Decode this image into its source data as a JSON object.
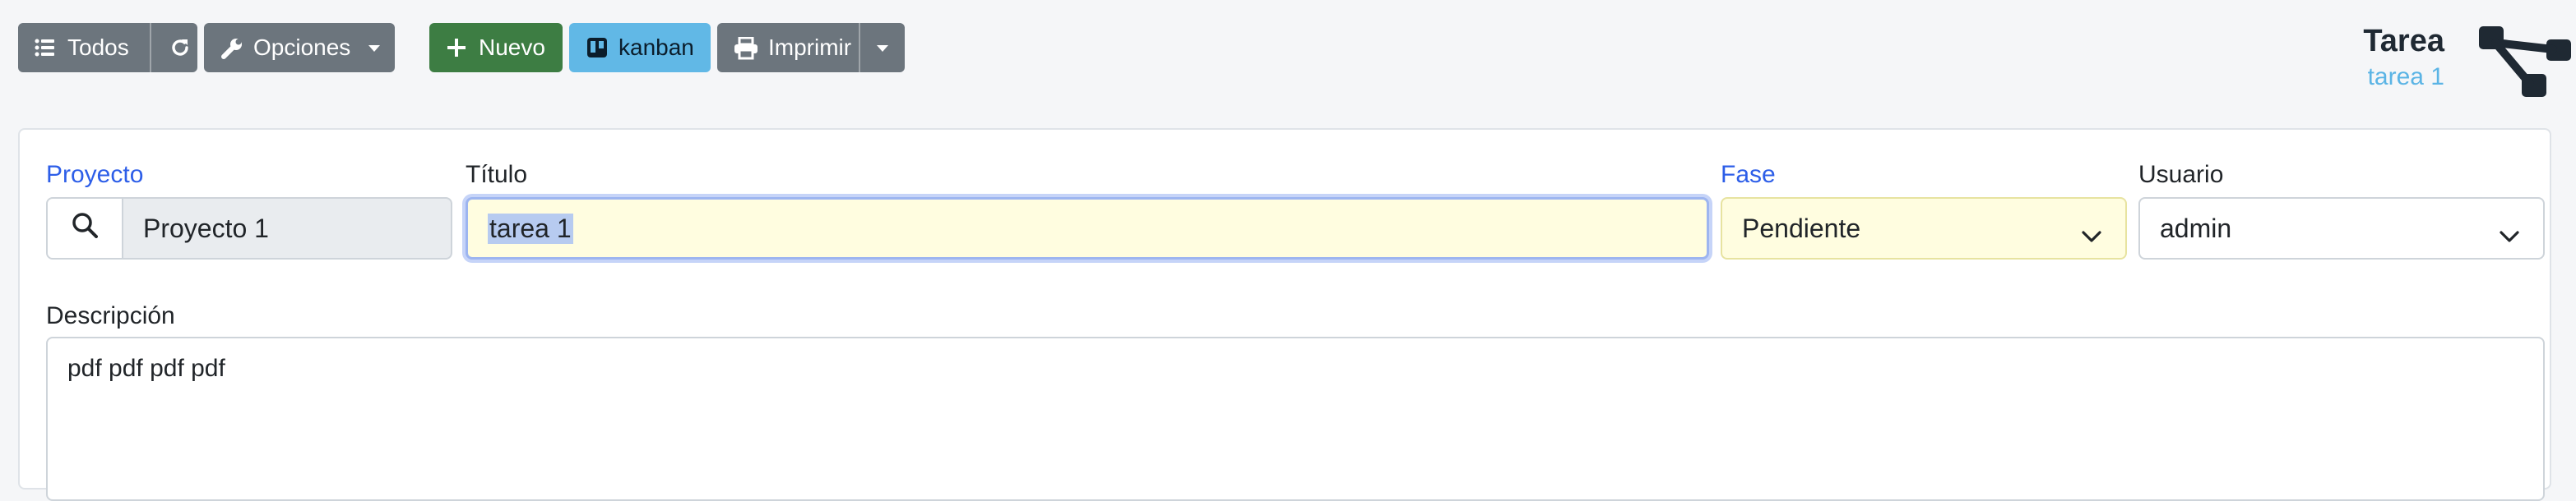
{
  "toolbar": {
    "todos_label": "Todos",
    "opciones_label": "Opciones",
    "nuevo_label": "Nuevo",
    "kanban_label": "kanban",
    "imprimir_label": "Imprimir"
  },
  "header": {
    "title": "Tarea",
    "subtitle": "tarea 1"
  },
  "form": {
    "proyecto": {
      "label": "Proyecto",
      "value": "Proyecto 1"
    },
    "titulo": {
      "label": "Título",
      "value": "tarea 1"
    },
    "fase": {
      "label": "Fase",
      "value": "Pendiente"
    },
    "usuario": {
      "label": "Usuario",
      "value": "admin"
    },
    "descripcion": {
      "label": "Descripción",
      "value": "pdf pdf pdf pdf"
    }
  },
  "colors": {
    "gray_button": "#6c757d",
    "green_button": "#3d7d43",
    "blue_button": "#61b8e6",
    "required_label": "#2d5ee8",
    "focus_field": "#fffde0",
    "disabled_field": "#e9ecef",
    "subtitle": "#5bb4e5"
  },
  "icons": [
    "list-icon",
    "refresh-icon",
    "wrench-icon",
    "plus-icon",
    "trello-icon",
    "printer-icon",
    "search-icon",
    "chevron-down-icon",
    "sitemap-logo-icon"
  ]
}
